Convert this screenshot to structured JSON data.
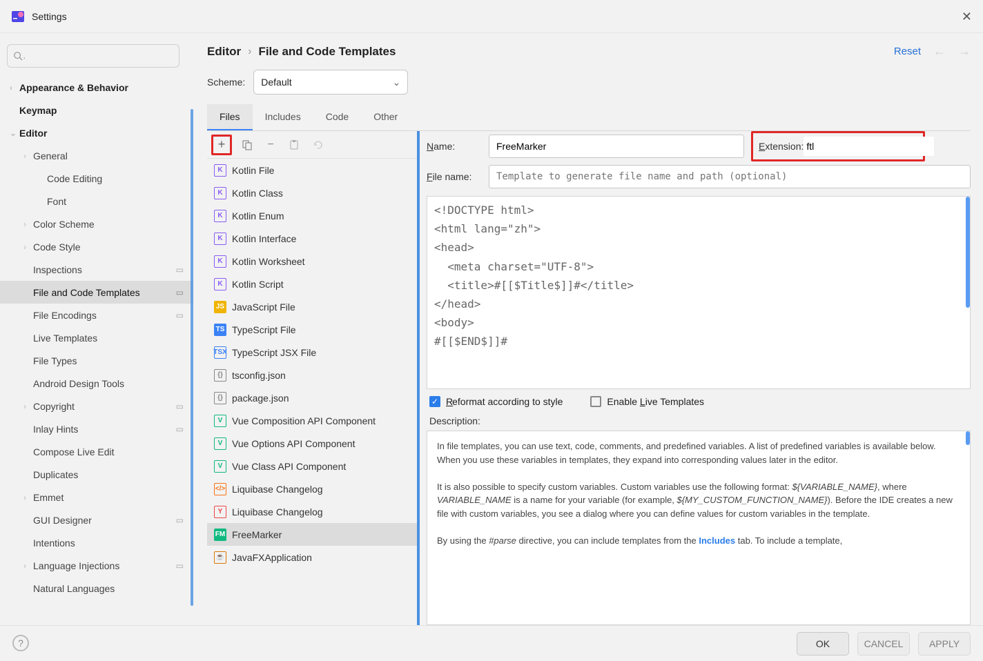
{
  "window": {
    "title": "Settings"
  },
  "header": {
    "crumb1": "Editor",
    "crumb2": "File and Code Templates",
    "reset": "Reset"
  },
  "sidebar": {
    "items": [
      {
        "label": "Appearance & Behavior",
        "lvl": 0,
        "bold": true,
        "caret": "›"
      },
      {
        "label": "Keymap",
        "lvl": 0,
        "bold": true
      },
      {
        "label": "Editor",
        "lvl": 0,
        "bold": true,
        "caret": "⌄"
      },
      {
        "label": "General",
        "lvl": 1,
        "caret": "›"
      },
      {
        "label": "Code Editing",
        "lvl": 2
      },
      {
        "label": "Font",
        "lvl": 2
      },
      {
        "label": "Color Scheme",
        "lvl": 1,
        "caret": "›"
      },
      {
        "label": "Code Style",
        "lvl": 1,
        "caret": "›"
      },
      {
        "label": "Inspections",
        "lvl": 1,
        "proj": true
      },
      {
        "label": "File and Code Templates",
        "lvl": 1,
        "selected": true,
        "proj": true
      },
      {
        "label": "File Encodings",
        "lvl": 1,
        "proj": true
      },
      {
        "label": "Live Templates",
        "lvl": 1
      },
      {
        "label": "File Types",
        "lvl": 1
      },
      {
        "label": "Android Design Tools",
        "lvl": 1
      },
      {
        "label": "Copyright",
        "lvl": 1,
        "caret": "›",
        "proj": true
      },
      {
        "label": "Inlay Hints",
        "lvl": 1,
        "proj": true
      },
      {
        "label": "Compose Live Edit",
        "lvl": 1
      },
      {
        "label": "Duplicates",
        "lvl": 1
      },
      {
        "label": "Emmet",
        "lvl": 1,
        "caret": "›"
      },
      {
        "label": "GUI Designer",
        "lvl": 1,
        "proj": true
      },
      {
        "label": "Intentions",
        "lvl": 1
      },
      {
        "label": "Language Injections",
        "lvl": 1,
        "caret": "›",
        "proj": true
      },
      {
        "label": "Natural Languages",
        "lvl": 1
      }
    ]
  },
  "scheme": {
    "label": "Scheme:",
    "value": "Default"
  },
  "tabs": [
    {
      "label": "Files",
      "active": true
    },
    {
      "label": "Includes"
    },
    {
      "label": "Code"
    },
    {
      "label": "Other"
    }
  ],
  "templates": [
    {
      "label": "Kotlin File",
      "icon": "K",
      "ic": "#8a5cf6"
    },
    {
      "label": "Kotlin Class",
      "icon": "K",
      "ic": "#8a5cf6"
    },
    {
      "label": "Kotlin Enum",
      "icon": "K",
      "ic": "#8a5cf6"
    },
    {
      "label": "Kotlin Interface",
      "icon": "K",
      "ic": "#8a5cf6"
    },
    {
      "label": "Kotlin Worksheet",
      "icon": "K",
      "ic": "#8a5cf6"
    },
    {
      "label": "Kotlin Script",
      "icon": "K",
      "ic": "#8a5cf6"
    },
    {
      "label": "JavaScript File",
      "icon": "JS",
      "ic": "#f0b400",
      "bg": true
    },
    {
      "label": "TypeScript File",
      "icon": "TS",
      "ic": "#3b82f6",
      "bg": true
    },
    {
      "label": "TypeScript JSX File",
      "icon": "TSX",
      "ic": "#3b82f6"
    },
    {
      "label": "tsconfig.json",
      "icon": "{}",
      "ic": "#888"
    },
    {
      "label": "package.json",
      "icon": "{}",
      "ic": "#888"
    },
    {
      "label": "Vue Composition API Component",
      "icon": "V",
      "ic": "#10b981"
    },
    {
      "label": "Vue Options API Component",
      "icon": "V",
      "ic": "#10b981"
    },
    {
      "label": "Vue Class API Component",
      "icon": "V",
      "ic": "#10b981"
    },
    {
      "label": "Liquibase Changelog",
      "icon": "</>",
      "ic": "#f97316"
    },
    {
      "label": "Liquibase Changelog",
      "icon": "Y",
      "ic": "#ef4444"
    },
    {
      "label": "FreeMarker",
      "icon": "FM",
      "ic": "#10b981",
      "bg": true,
      "selected": true
    },
    {
      "label": "JavaFXApplication",
      "icon": "☕",
      "ic": "#d97706"
    }
  ],
  "fields": {
    "name_label": "Name:",
    "name_value": "FreeMarker",
    "ext_label": "Extension:",
    "ext_value": "ftl",
    "file_label": "File name:",
    "file_placeholder": "Template to generate file name and path (optional)"
  },
  "code": "<!DOCTYPE html>\n<html lang=\"zh\">\n<head>\n  <meta charset=\"UTF-8\">\n  <title>#[[$Title$]]#</title>\n</head>\n<body>\n#[[$END$]]#",
  "checks": {
    "reformat": "Reformat according to style",
    "live": "Enable Live Templates"
  },
  "desc": {
    "title": "Description:",
    "p1a": "In file templates, you can use text, code, comments, and predefined variables. A list of predefined variables is available below. When you use these variables in templates, they expand into corresponding values later in the editor.",
    "p2a": "It is also possible to specify custom variables. Custom variables use the following format: ",
    "p2b": "${VARIABLE_NAME}",
    "p2c": ", where ",
    "p2d": "VARIABLE_NAME",
    "p2e": " is a name for your variable (for example, ",
    "p2f": "${MY_CUSTOM_FUNCTION_NAME}",
    "p2g": "). Before the IDE creates a new file with custom variables, you see a dialog where you can define values for custom variables in the template.",
    "p3a": "By using the ",
    "p3b": "#parse",
    "p3c": " directive, you can include templates from the ",
    "p3d": "Includes",
    "p3e": " tab. To include a template,"
  },
  "buttons": {
    "ok": "OK",
    "cancel": "CANCEL",
    "apply": "APPLY"
  }
}
